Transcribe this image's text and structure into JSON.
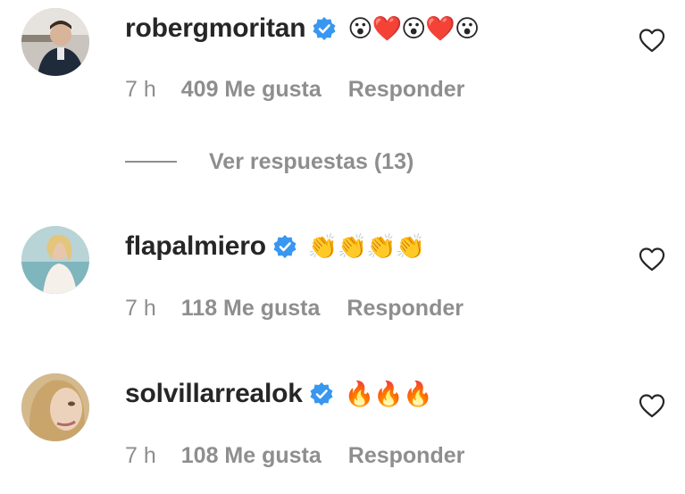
{
  "comments": [
    {
      "username": "robergmoritan",
      "text": "😮❤️😮❤️😮",
      "time": "7 h",
      "likes": "409 Me gusta",
      "reply": "Responder"
    },
    {
      "username": "flapalmiero",
      "text": "👏👏👏👏",
      "time": "7 h",
      "likes": "118 Me gusta",
      "reply": "Responder"
    },
    {
      "username": "solvillarrealok",
      "text": "🔥🔥🔥",
      "time": "7 h",
      "likes": "108 Me gusta",
      "reply": "Responder"
    }
  ],
  "view_replies": "Ver respuestas (13)",
  "icons": {
    "verified": "verified-badge-icon",
    "like": "heart-outline-icon"
  },
  "colors": {
    "text": "#262626",
    "muted": "#8e8e8e",
    "verified_blue": "#3897f0"
  }
}
